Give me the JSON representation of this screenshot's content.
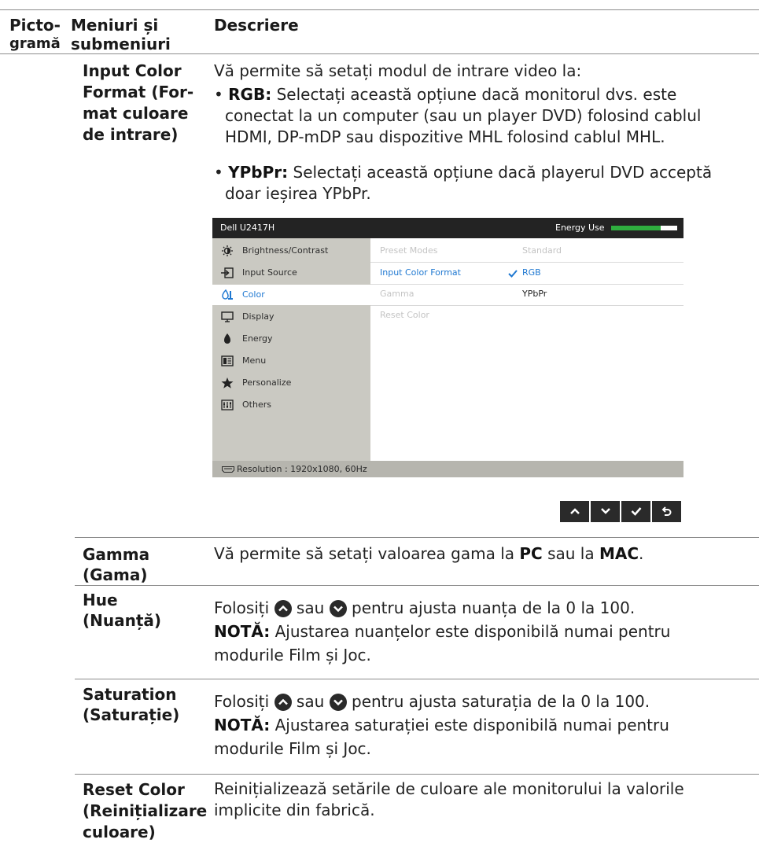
{
  "header": {
    "col1_line1": "Picto-",
    "col1_line2": "gramă",
    "col2_line1": "Meniuri și",
    "col2_line2": "submeniuri",
    "col3": "Descriere"
  },
  "input_color_format": {
    "term_lines": [
      "Input Color",
      "Format (For-",
      "mat culoare",
      "de intrare)"
    ],
    "intro": "Vă permite să setați modul de intrare video la:",
    "rgb_label": "RGB:",
    "rgb_line1": " Selectați această opțiune dacă monitorul dvs. este",
    "rgb_line2": "conectat la un computer (sau un player DVD) folosind cablul",
    "rgb_line3": "HDMI, DP-mDP sau dispozitive MHL folosind cablul MHL.",
    "ypbpr_label": "YPbPr:",
    "ypbpr_line1": " Selectați această opțiune dacă playerul DVD acceptă",
    "ypbpr_line2": "doar ieșirea YPbPr."
  },
  "osd": {
    "model": "Dell U2417H",
    "energy_label": "Energy Use",
    "energy_level": 0.75,
    "menu": [
      {
        "label": "Brightness/Contrast",
        "icon": "brightness-icon"
      },
      {
        "label": "Input Source",
        "icon": "input-source-icon"
      },
      {
        "label": "Color",
        "icon": "color-icon",
        "selected": true
      },
      {
        "label": "Display",
        "icon": "display-icon"
      },
      {
        "label": "Energy",
        "icon": "energy-icon"
      },
      {
        "label": "Menu",
        "icon": "menu-icon"
      },
      {
        "label": "Personalize",
        "icon": "star-icon"
      },
      {
        "label": "Others",
        "icon": "others-icon"
      }
    ],
    "options": [
      {
        "label": "Preset Modes",
        "value": "Standard"
      },
      {
        "label": "Input Color Format",
        "value": "RGB"
      },
      {
        "label": "Gamma",
        "value": "YPbPr"
      },
      {
        "label": "Reset Color",
        "value": ""
      }
    ],
    "resolution": "Resolution : 1920x1080, 60Hz",
    "colors": {
      "topbar": "#232323",
      "sidebar": "#cac9c2",
      "bottombar": "#b6b5ae",
      "energy_bar": "#2fae3f",
      "accent": "#1f78d1"
    }
  },
  "nav_buttons": [
    "up-icon",
    "down-icon",
    "check-icon",
    "back-icon"
  ],
  "gamma": {
    "term_lines": [
      "Gamma",
      "(Gama)"
    ],
    "text_pre": "Vă permite să setați valoarea gama la ",
    "pc": "PC",
    "text_mid": " sau la ",
    "mac": "MAC",
    "text_end": "."
  },
  "hue": {
    "term_lines": [
      "Hue",
      "(Nuanță)"
    ],
    "line1_pre": "Folosiți ",
    "line1_mid": " sau ",
    "line1_post": " pentru ajusta nuanța de la 0 la 100.",
    "note_label": "NOTĂ:",
    "note_line1": " Ajustarea nuanțelor este disponibilă numai pentru",
    "note_line2": "modurile Film și Joc."
  },
  "saturation": {
    "term_lines": [
      "Saturation",
      "(Saturație)"
    ],
    "line1_pre": "Folosiți ",
    "line1_mid": " sau ",
    "line1_post": "  pentru ajusta saturația de la 0 la 100.",
    "note_label": "NOTĂ:",
    "note_line1": " Ajustarea saturației este disponibilă numai pentru",
    "note_line2": "modurile Film și Joc."
  },
  "reset_color": {
    "term_lines": [
      "Reset Color",
      "(Reinițializare",
      "culoare)"
    ],
    "line1": "Reinițializează setările de culoare ale monitorului la valorile",
    "line2": "implicite din fabrică."
  }
}
